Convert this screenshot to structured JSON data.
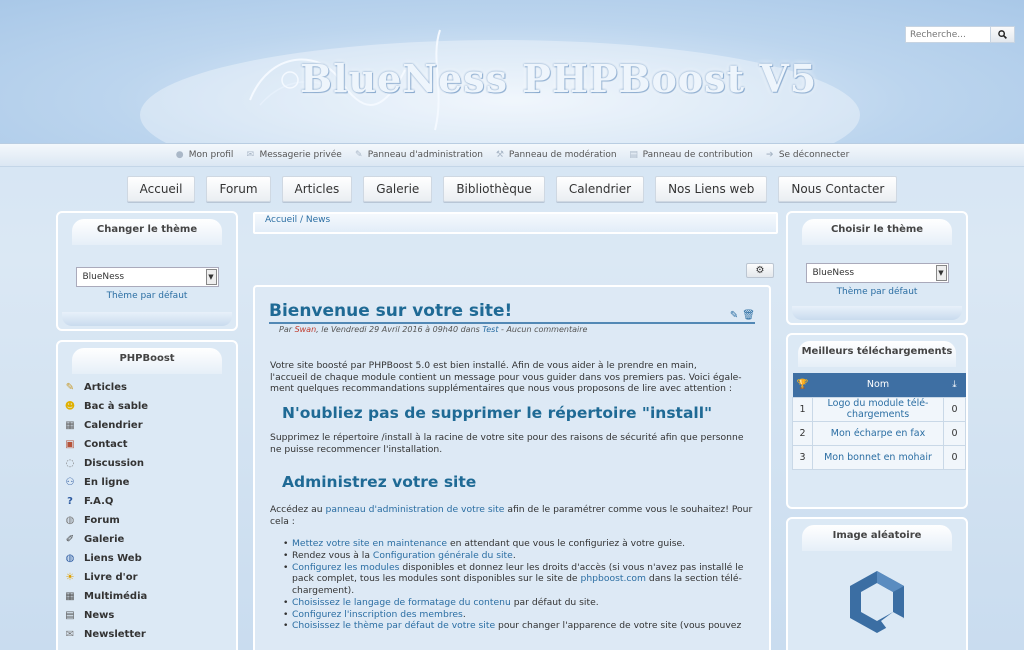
{
  "header": {
    "logo_text": "BlueNess PHPBoost V5",
    "search_placeholder": "Recherche..."
  },
  "userbar": [
    {
      "label": "Mon profil",
      "icon": "user-icon"
    },
    {
      "label": "Messagerie privée",
      "icon": "envelope-icon"
    },
    {
      "label": "Panneau d'administration",
      "icon": "wrench-icon"
    },
    {
      "label": "Panneau de modération",
      "icon": "gavel-icon"
    },
    {
      "label": "Panneau de contribution",
      "icon": "file-icon"
    },
    {
      "label": "Se déconnecter",
      "icon": "signout-icon"
    }
  ],
  "nav": [
    "Accueil",
    "Forum",
    "Articles",
    "Galerie",
    "Bibliothèque",
    "Calendrier",
    "Nos Liens web",
    "Nous Contacter"
  ],
  "left_theme": {
    "title": "Changer le thème",
    "selected": "BlueNess",
    "link": "Thème par défaut"
  },
  "left_menu": {
    "title": "PHPBoost",
    "items": [
      "Articles",
      "Bac à sable",
      "Calendrier",
      "Contact",
      "Discussion",
      "En ligne",
      "F.A.Q",
      "Forum",
      "Galerie",
      "Liens Web",
      "Livre d'or",
      "Multimédia",
      "News",
      "Newsletter"
    ]
  },
  "breadcrumb": {
    "home": "Accueil",
    "sep": " / ",
    "current": "News"
  },
  "article": {
    "title": "Bienvenue sur votre site!",
    "meta_by": "Par ",
    "meta_author": "Swan",
    "meta_date": ", le Vendredi 29 Avril 2016 à 09h40 dans ",
    "meta_category": "Test",
    "meta_comments": " - Aucun commentaire",
    "intro_l1": "Votre site boosté par PHPBoost 5.0 est bien installé. Afin de vous aider à le prendre en main,",
    "intro_l2": "l'accueil de chaque module contient un message pour vous guider dans vos premiers pas. Voici égale-",
    "intro_l3": "ment quelques recommandations supplémentaires que nous vous proposons de lire avec attention :",
    "h_install": "N'oubliez pas de supprimer le répertoire \"install\"",
    "install_l1": "Supprimez le répertoire /install à la racine de votre site pour des raisons de sécurité afin que personne",
    "install_l2": "ne puisse recommencer l'installation.",
    "h_admin": "Administrez votre site",
    "admin_a": "Accédez au ",
    "admin_link": "panneau d'administration de votre site",
    "admin_b": " afin de le paramétrer comme vous le souhaitez! Pour",
    "admin_c": "cela :",
    "li1_link": "Mettez votre site en maintenance",
    "li1_rest": " en attendant que vous le configuriez à votre guise.",
    "li2_a": "Rendez vous à la ",
    "li2_link": "Configuration générale du site",
    "li2_b": ".",
    "li3_link": "Configurez les modules",
    "li3_a": " disponibles et donnez leur les droits d'accès (si vous n'avez pas installé le",
    "li3_b": "pack complet, tous les modules sont disponibles sur le site de ",
    "li3_link2": "phpboost.com",
    "li3_c": " dans la section télé-",
    "li3_d": "chargement).",
    "li4_link": "Choisissez le langage de formatage du contenu",
    "li4_rest": " par défaut du site.",
    "li5_link": "Configurez l'inscription des membres",
    "li5_rest": ".",
    "li6_link": "Choisissez le thème par défaut de votre site",
    "li6_rest": " pour changer l'apparence de votre site (vous pouvez"
  },
  "right_theme": {
    "title": "Choisir le thème",
    "selected": "BlueNess",
    "link": "Thème par défaut"
  },
  "downloads": {
    "title": "Meilleurs téléchargements",
    "col_name": "Nom",
    "rows": [
      {
        "rank": "1",
        "name_l1": "Logo du module télé-",
        "name_l2": "chargements",
        "count": "0"
      },
      {
        "rank": "2",
        "name_l1": "Mon écharpe en fax",
        "name_l2": "",
        "count": "0"
      },
      {
        "rank": "3",
        "name_l1": "Mon bonnet en mohair",
        "name_l2": "",
        "count": "0"
      }
    ]
  },
  "random_image": {
    "title": "Image aléatoire"
  }
}
